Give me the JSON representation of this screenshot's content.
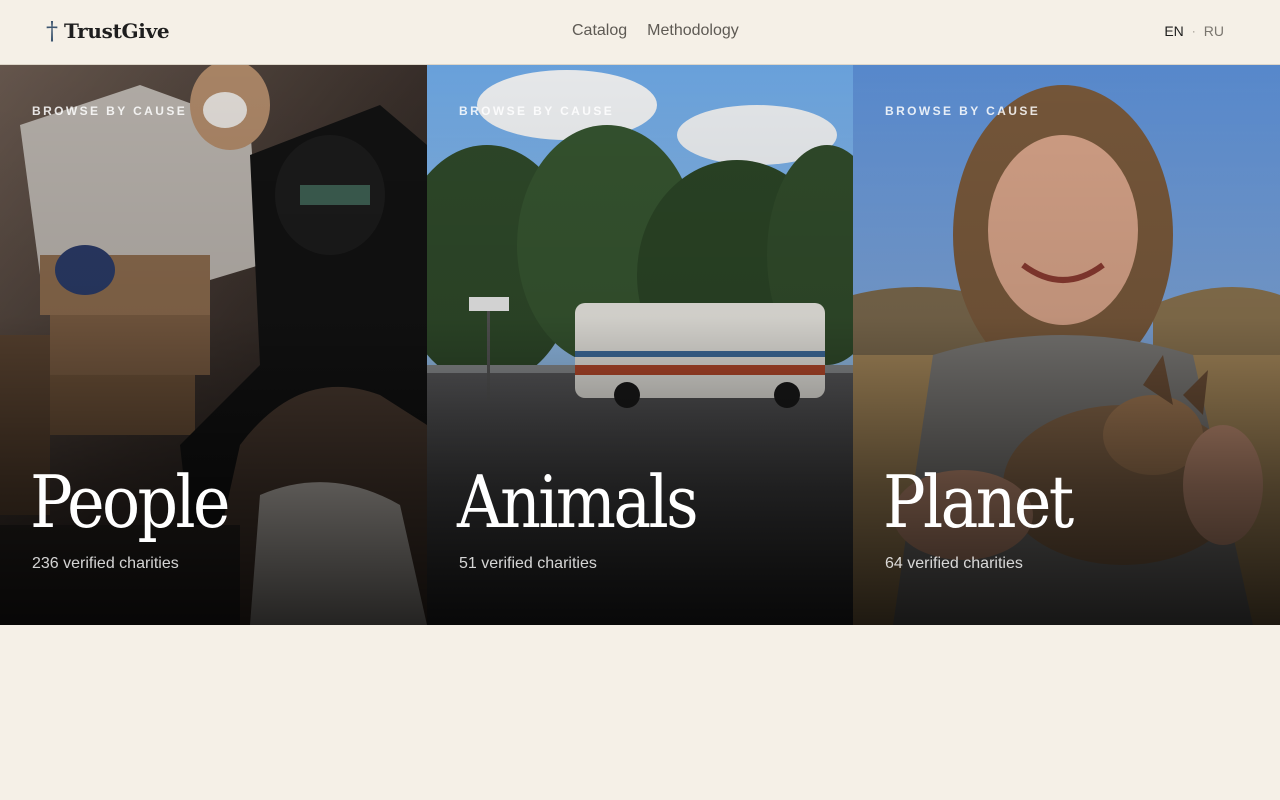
{
  "header": {
    "logo_icon": "cross-icon",
    "logo_glyph": "†",
    "logo_text": "TrustGive",
    "nav": [
      {
        "label": "Catalog"
      },
      {
        "label": "Methodology"
      }
    ],
    "lang": {
      "active": "EN",
      "separator": "·",
      "inactive": "RU"
    }
  },
  "causes": [
    {
      "eyebrow": "BROWSE BY CAUSE",
      "title": "People",
      "count": "236 verified charities"
    },
    {
      "eyebrow": "BROWSE BY CAUSE",
      "title": "Animals",
      "count": "51 verified charities"
    },
    {
      "eyebrow": "BROWSE BY CAUSE",
      "title": "Planet",
      "count": "64 verified charities"
    }
  ],
  "colors": {
    "background": "#f5f0e7",
    "logo_cross": "#3d5670",
    "text_dark": "#1e1e1e",
    "nav_text": "#5e5a54"
  }
}
